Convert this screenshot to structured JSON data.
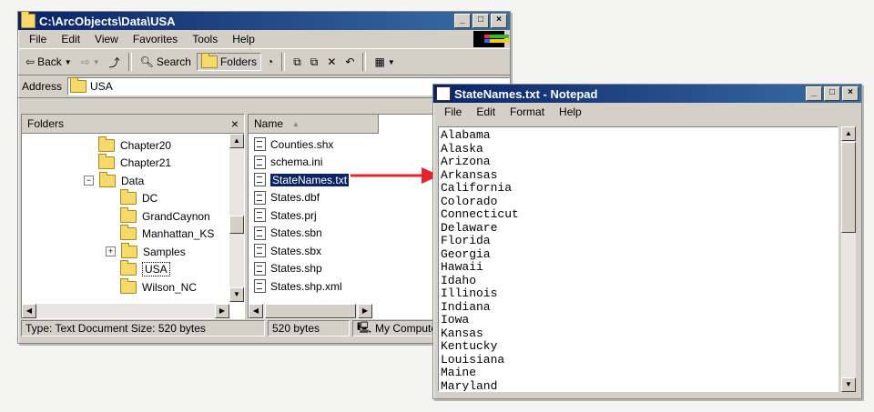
{
  "explorer": {
    "title": "C:\\ArcObjects\\Data\\USA",
    "menu": [
      "File",
      "Edit",
      "View",
      "Favorites",
      "Tools",
      "Help"
    ],
    "toolbar": {
      "back": "Back",
      "search": "Search",
      "folders": "Folders"
    },
    "address_label": "Address",
    "address_value": "USA",
    "folders_header": "Folders",
    "folders_close": "×",
    "tree": [
      "Chapter20",
      "Chapter21",
      "Data",
      "DC",
      "GrandCaynon",
      "Manhattan_KS",
      "Samples",
      "USA",
      "Wilson_NC"
    ],
    "name_header": "Name",
    "files": [
      "Counties.shx",
      "schema.ini",
      "StateNames.txt",
      "States.dbf",
      "States.prj",
      "States.sbn",
      "States.sbx",
      "States.shp",
      "States.shp.xml"
    ],
    "status_left": "Type: Text Document Size: 520 bytes",
    "status_size": "520 bytes",
    "status_location": "My Compute"
  },
  "notepad": {
    "title": "StateNames.txt - Notepad",
    "menu": [
      "File",
      "Edit",
      "Format",
      "Help"
    ],
    "lines": [
      "Alabama",
      "Alaska",
      "Arizona",
      "Arkansas",
      "California",
      "Colorado",
      "Connecticut",
      "Delaware",
      "Florida",
      "Georgia",
      "Hawaii",
      "Idaho",
      "Illinois",
      "Indiana",
      "Iowa",
      "Kansas",
      "Kentucky",
      "Louisiana",
      "Maine",
      "Maryland"
    ]
  },
  "window_buttons": {
    "minimize": "_",
    "maximize": "□",
    "close": "×"
  },
  "colors": {
    "title_active": "#0a246a",
    "arrow": "#e8212a",
    "selection": "#0a246a"
  }
}
